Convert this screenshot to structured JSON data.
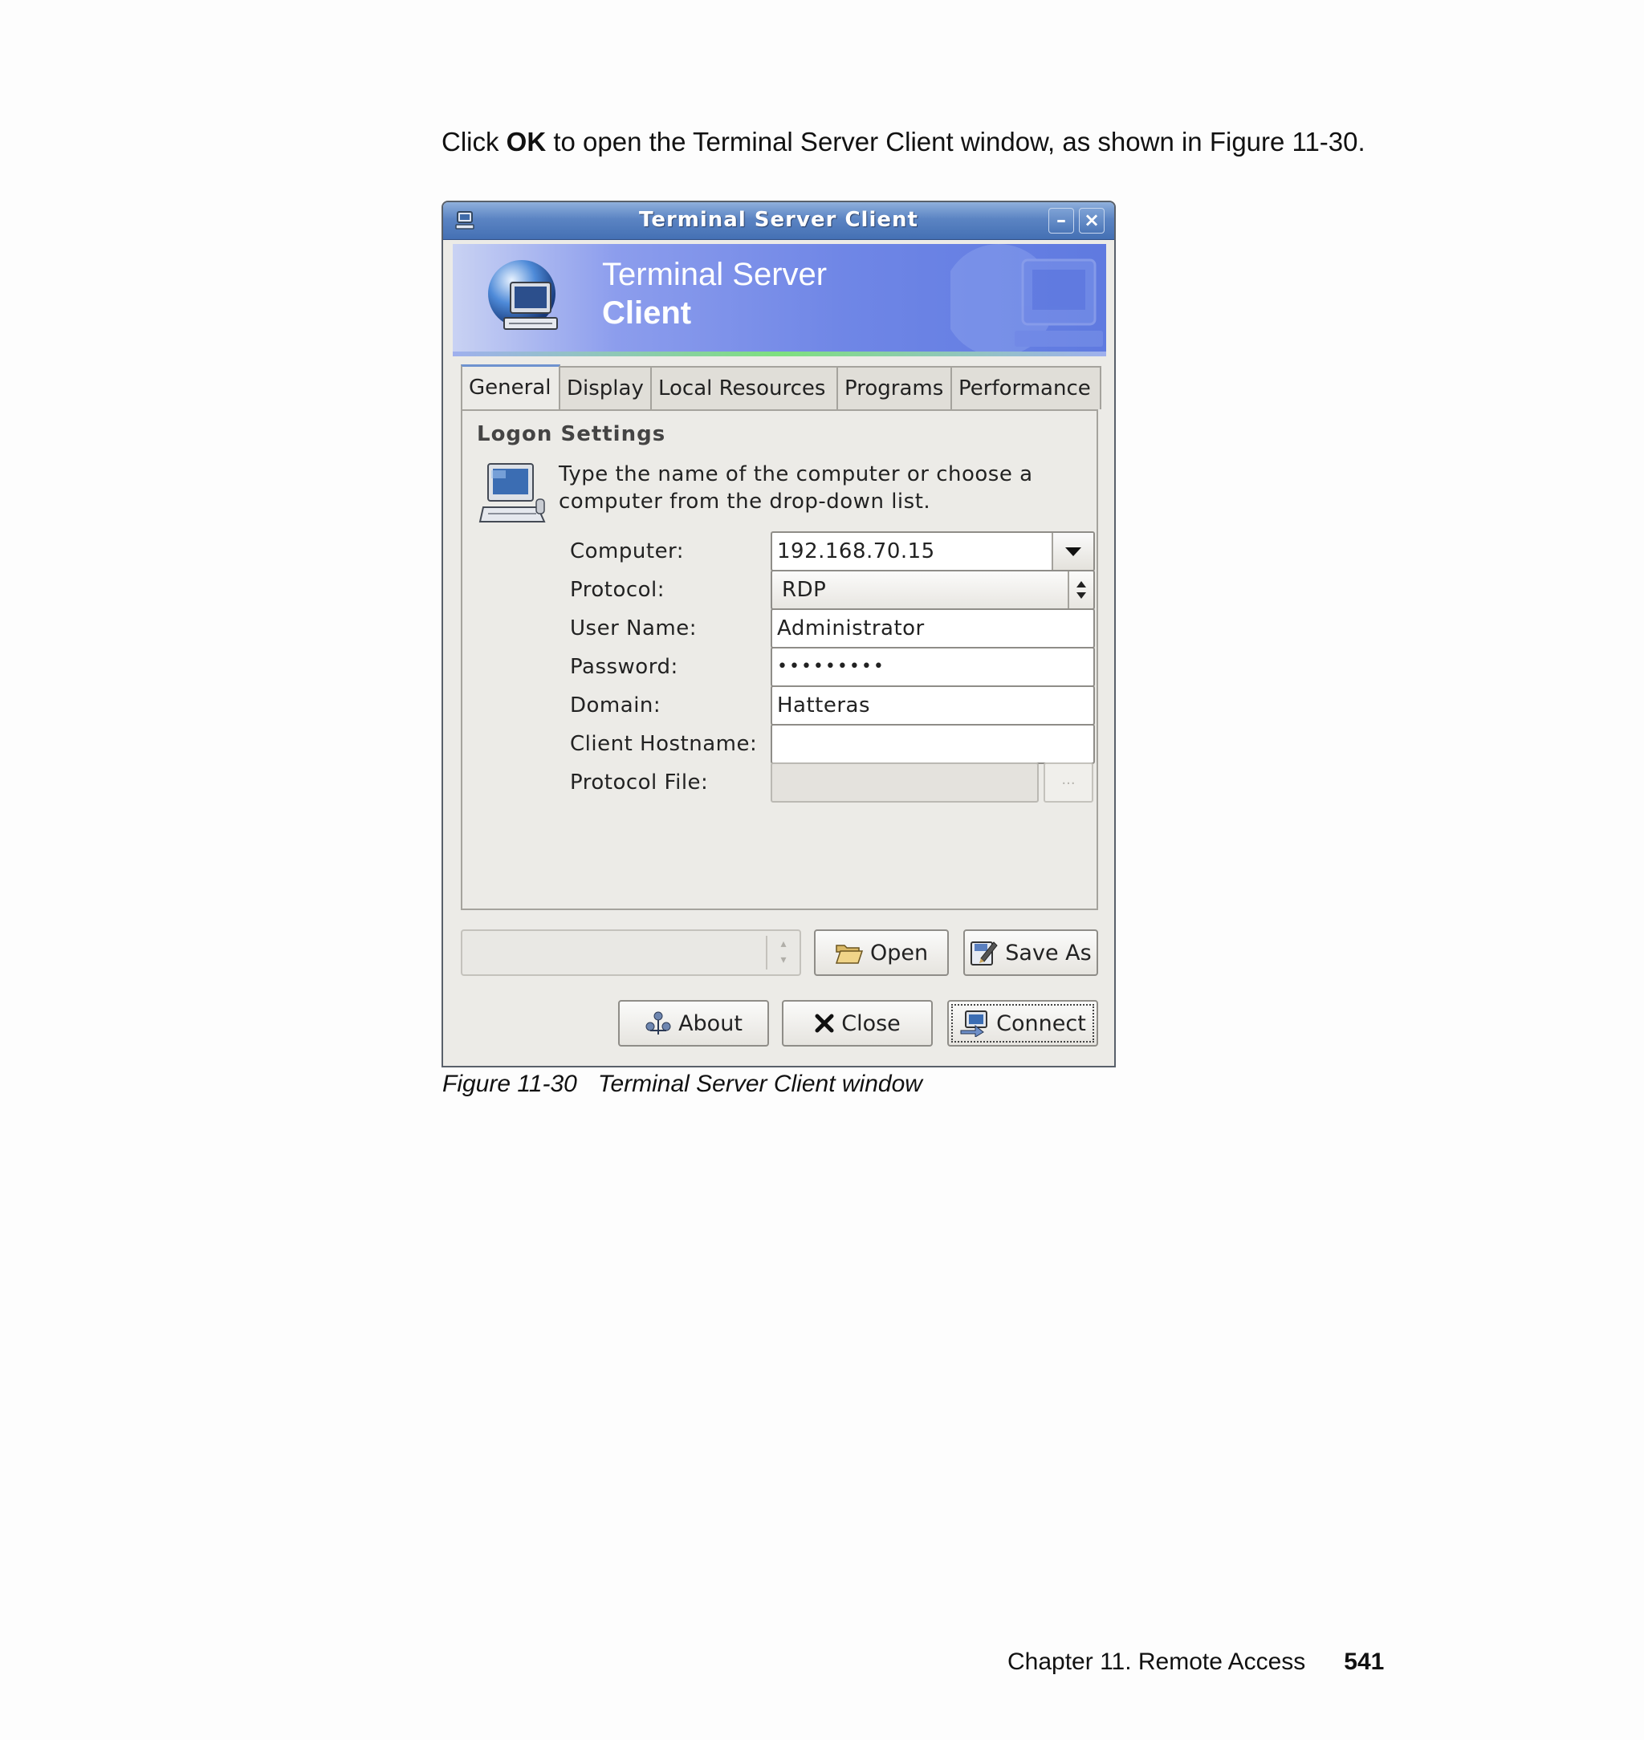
{
  "document": {
    "intro_before": "Click ",
    "intro_bold": "OK",
    "intro_after": " to open the Terminal Server Client window, as shown in Figure 11-30.",
    "caption_figure": "Figure 11-30",
    "caption_title": "Terminal Server Client window",
    "footer_chapter": "Chapter 11. Remote Access",
    "footer_page": "541"
  },
  "window": {
    "title": "Terminal Server Client",
    "minimize_label": "–",
    "close_label": "×",
    "banner_line1": "Terminal Server",
    "banner_line2": "Client"
  },
  "tabs": [
    {
      "label": "General",
      "active": true
    },
    {
      "label": "Display"
    },
    {
      "label": "Local Resources"
    },
    {
      "label": "Programs"
    },
    {
      "label": "Performance"
    }
  ],
  "logon": {
    "section_title": "Logon Settings",
    "description": "Type the name of the computer or choose a computer from the drop-down list.",
    "fields": {
      "computer": {
        "label": "Computer:",
        "value": "192.168.70.15"
      },
      "protocol": {
        "label": "Protocol:",
        "value": "RDP"
      },
      "username": {
        "label": "User Name:",
        "value": "Administrator"
      },
      "password": {
        "label": "Password:",
        "value": "•••••••••"
      },
      "domain": {
        "label": "Domain:",
        "value": "Hatteras"
      },
      "client_hostname": {
        "label": "Client Hostname:",
        "value": ""
      },
      "protocol_file": {
        "label": "Protocol File:",
        "value": ""
      }
    },
    "browse_label": "..."
  },
  "buttons": {
    "open": "Open",
    "save_as": "Save As",
    "about": "About",
    "close": "Close",
    "connect": "Connect"
  },
  "colors": {
    "titlebar": "#4470b4",
    "banner": "#6f86e6",
    "window_bg": "#ecebe7"
  }
}
